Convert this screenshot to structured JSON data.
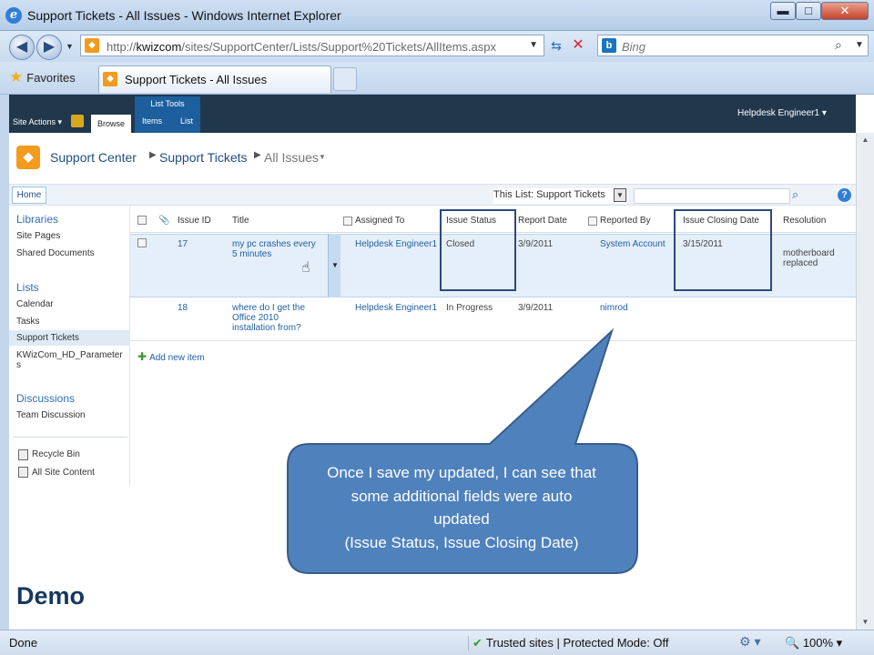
{
  "window": {
    "title": "Support Tickets - All Issues - Windows Internet Explorer",
    "min": "▬",
    "max": "□",
    "close": "✕"
  },
  "address": {
    "url_prefix": "http://",
    "url_host": "kwizcom",
    "url_path": "/sites/SupportCenter/Lists/Support%20Tickets/AllItems.aspx",
    "search_placeholder": "Bing"
  },
  "tabs": {
    "favorites_label": "Favorites",
    "active_tab": "Support Tickets - All Issues"
  },
  "ribbon": {
    "site_actions": "Site Actions ▾",
    "browse": "Browse",
    "list_tools": "List Tools",
    "items": "Items",
    "list": "List",
    "user": "Helpdesk Engineer1 ▾"
  },
  "breadcrumb": {
    "site": "Support Center",
    "list": "Support Tickets",
    "view": "All Issues"
  },
  "topnav": {
    "home": "Home",
    "scope": "This List: Support Tickets"
  },
  "leftnav": {
    "libraries_heading": "Libraries",
    "site_pages": "Site Pages",
    "shared_documents": "Shared Documents",
    "lists_heading": "Lists",
    "calendar": "Calendar",
    "tasks": "Tasks",
    "support_tickets": "Support Tickets",
    "kwizcom_params_line1": "KWizCom_HD_Parameter",
    "kwizcom_params_line2": "s",
    "discussions_heading": "Discussions",
    "team_discussion": "Team Discussion",
    "recycle_bin": "Recycle Bin",
    "all_site_content": "All Site Content"
  },
  "table": {
    "headers": {
      "issue_id": "Issue ID",
      "title": "Title",
      "assigned_to": "Assigned To",
      "issue_status": "Issue Status",
      "report_date": "Report Date",
      "reported_by": "Reported By",
      "issue_closing_date": "Issue Closing Date",
      "resolution": "Resolution"
    },
    "rows": [
      {
        "issue_id": "17",
        "title_line1": "my pc crashes every",
        "title_line2": "5 minutes",
        "assigned_to": "Helpdesk Engineer1",
        "issue_status": "Closed",
        "report_date": "3/9/2011",
        "reported_by": "System Account",
        "issue_closing_date": "3/15/2011",
        "resolution_line1": "motherboard",
        "resolution_line2": "replaced"
      },
      {
        "issue_id": "18",
        "title_line1": "where do I get the",
        "title_line2": "Office 2010",
        "title_line3": "installation from?",
        "assigned_to": "Helpdesk Engineer1",
        "issue_status": "In Progress",
        "report_date": "3/9/2011",
        "reported_by": "nimrod",
        "issue_closing_date": "",
        "resolution_line1": "",
        "resolution_line2": ""
      }
    ],
    "add_new_item": "Add new item"
  },
  "callout": {
    "line1": "Once I save my updated, I can see that",
    "line2": "some additional fields were auto",
    "line3": "updated",
    "line4": "(Issue Status, Issue Closing Date)"
  },
  "demo_label": "Demo",
  "statusbar": {
    "done": "Done",
    "zone": "Trusted sites | Protected Mode: Off",
    "zoom": "100%"
  },
  "colors": {
    "callout_fill": "#4f81bd",
    "callout_border": "#385d8a",
    "highlight_border": "#2b4a7c",
    "ribbon_bg": "#21374c",
    "link": "#1f5fa8"
  }
}
